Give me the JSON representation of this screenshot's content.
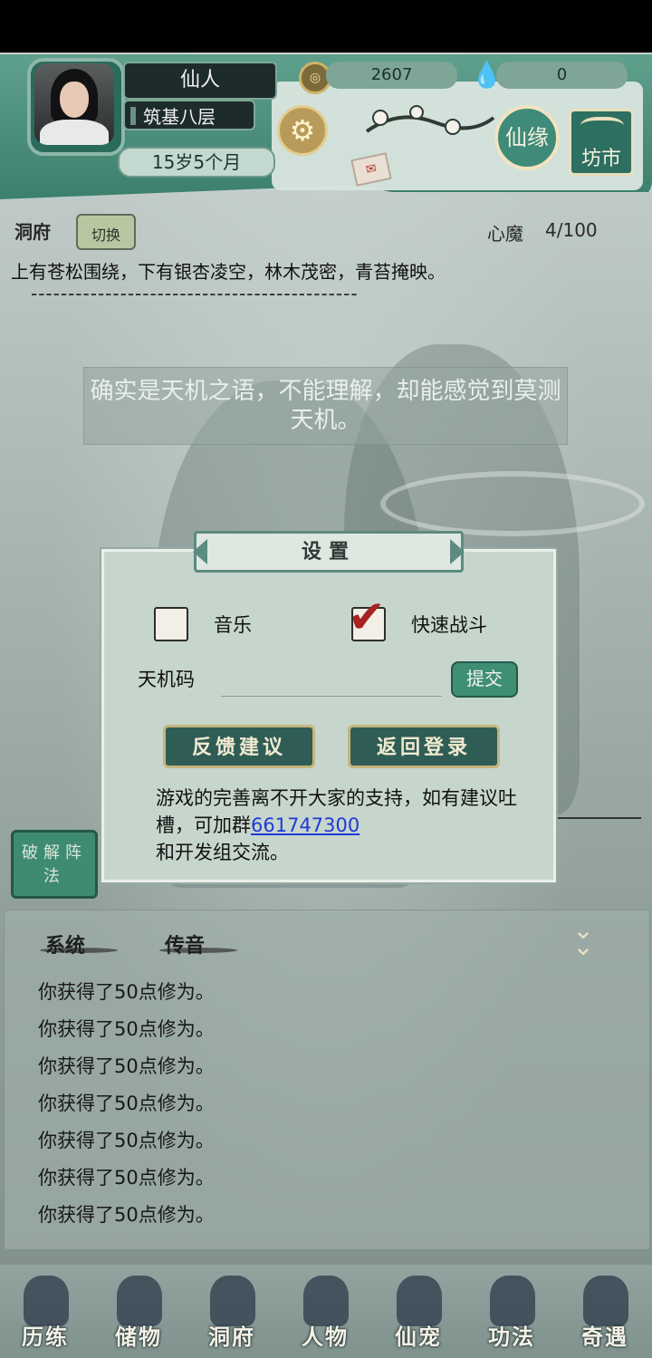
{
  "header": {
    "player_name": "仙人",
    "realm": "筑基八层",
    "age": "15岁5个月",
    "coins": "2607",
    "spirit_stones": "0",
    "xianyuan_label": "仙缘",
    "fangshi_label": "坊市",
    "icons": {
      "coin": "copper-coin-icon",
      "drop": "spirit-drop-icon",
      "settings": "gear-icon",
      "mail": "letter-icon"
    }
  },
  "cave": {
    "label": "洞府",
    "switch_label": "切换",
    "demon_label": "心魔",
    "demon_value": "4/100",
    "description": "上有苍松围绕，下有银杏凌空，林木茂密，青苔掩映。",
    "dashes": "--------------------------------------------",
    "tianji_note": "确实是天机之语，不能理解，却能感觉到莫测天机。"
  },
  "settings": {
    "title": "设置",
    "music_label": "音乐",
    "music_checked": false,
    "fast_battle_label": "快速战斗",
    "fast_battle_checked": true,
    "code_label": "天机码",
    "code_value": "",
    "submit_label": "提交",
    "feedback_label": "反馈建议",
    "relogin_label": "返回登录",
    "support_text_1": "游戏的完善离不开大家的支持，如有建议吐槽，可加群",
    "support_group": "661747300",
    "support_text_2": "和开发组交流。"
  },
  "side": {
    "array_label": "破解阵法"
  },
  "chat": {
    "tab_system": "系统",
    "tab_message": "传音",
    "lines": [
      "你获得了50点修为。",
      "你获得了50点修为。",
      "你获得了50点修为。",
      "你获得了50点修为。",
      "你获得了50点修为。",
      "你获得了50点修为。",
      "你获得了50点修为。"
    ]
  },
  "nav": {
    "items": [
      "历练",
      "储物",
      "洞府",
      "人物",
      "仙宠",
      "功法",
      "奇遇"
    ]
  },
  "colors": {
    "accent_green": "#3f8f74",
    "dialog_bg": "#c7d6cd",
    "link_blue": "#1f39d6",
    "check_red": "#a82222"
  }
}
